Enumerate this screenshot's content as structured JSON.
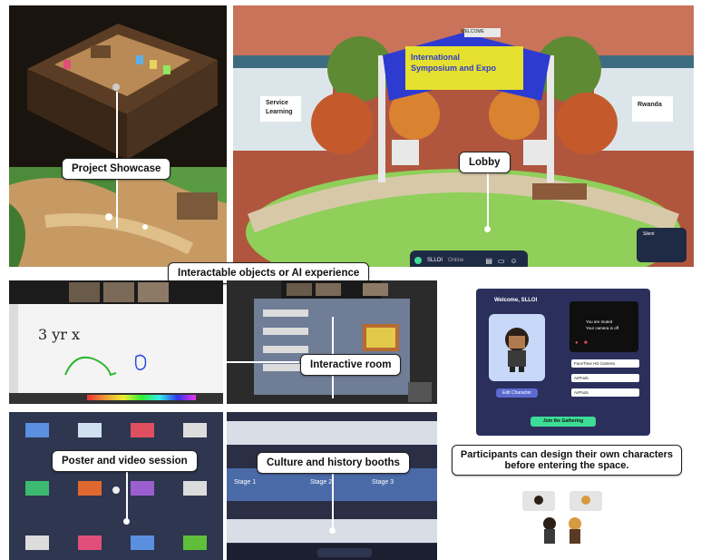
{
  "callouts": {
    "project_showcase": "Project Showcase",
    "lobby": "Lobby",
    "interactable": "Interactable objects or AI experience",
    "interactive_room": "Interactive room",
    "poster_session": "Poster and video session",
    "culture_booths": "Culture and history booths",
    "participants": "Participants can design their own characters before entering the space."
  },
  "lobby": {
    "sign_top": "WELCOME",
    "banner_line1": "International",
    "banner_line2": "Symposium and Expo",
    "left_building_sign_1": "Service",
    "left_building_sign_2": "Learning",
    "right_building_sign": "Rwanda",
    "toolbar_name": "SLLOI",
    "toolbar_status": "Online",
    "corner_label": "Silent"
  },
  "whiteboard": {
    "scribble": "3 yr x"
  },
  "booths": {
    "stage1": "Stage 1",
    "stage2": "Stage 2",
    "stage3": "Stage 3"
  },
  "setup": {
    "welcome": "Welcome, SLLOI",
    "video_off_1": "You are muted",
    "video_off_2": "Your camera is off",
    "edit_button": "Edit Character",
    "camera": "FaceTime HD Camera",
    "mic": "AirPods",
    "speaker": "AirPods",
    "join_button": "Join the Gathering"
  },
  "colors": {
    "accent_green": "#3ddc97",
    "setup_bg": "#2b2f5c",
    "grass": "#8fcf5a"
  }
}
